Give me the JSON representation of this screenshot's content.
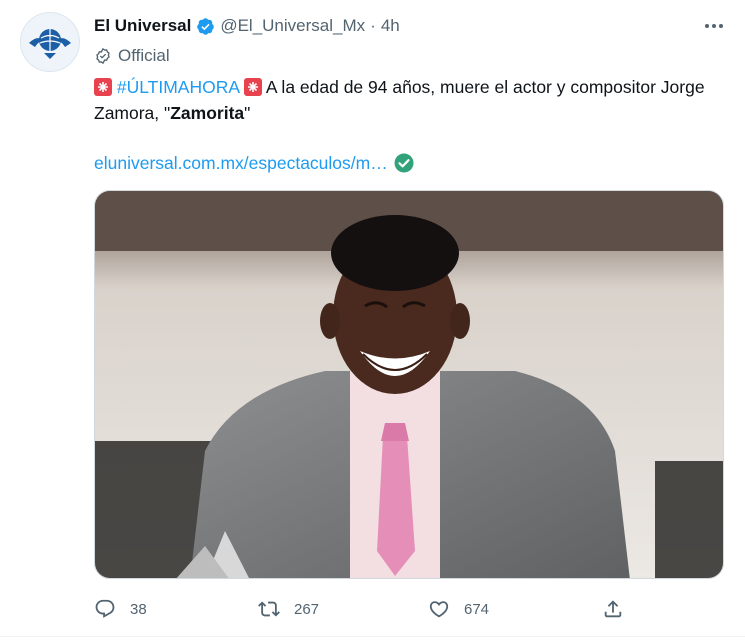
{
  "tweet": {
    "author_name": "El Universal",
    "handle": "@El_Universal_Mx",
    "separator": "·",
    "time": "4h",
    "official_label": "Official",
    "text_part1": "#ÚLTIMAHORA",
    "text_part2": " A la edad de 94 años, muere el actor y compositor Jorge Zamora, \"",
    "text_bold": "Zamorita",
    "text_part3": "\"",
    "link_text": "eluniversal.com.mx/espectaculos/m…"
  },
  "icons": {
    "verified": "verified-badge-icon",
    "official": "official-badge-icon",
    "siren": "rotating-light-emoji-icon",
    "link_check": "check-mark-button-emoji-icon",
    "more": "more-icon",
    "reply": "reply-icon",
    "retweet": "retweet-icon",
    "like": "like-icon",
    "share": "share-icon"
  },
  "actions": {
    "replies": "38",
    "retweets": "267",
    "likes": "674"
  },
  "colors": {
    "accent": "#1d9bf0",
    "secondary_text": "#536471",
    "primary_text": "#0f1419",
    "check_green": "#31a27a"
  }
}
